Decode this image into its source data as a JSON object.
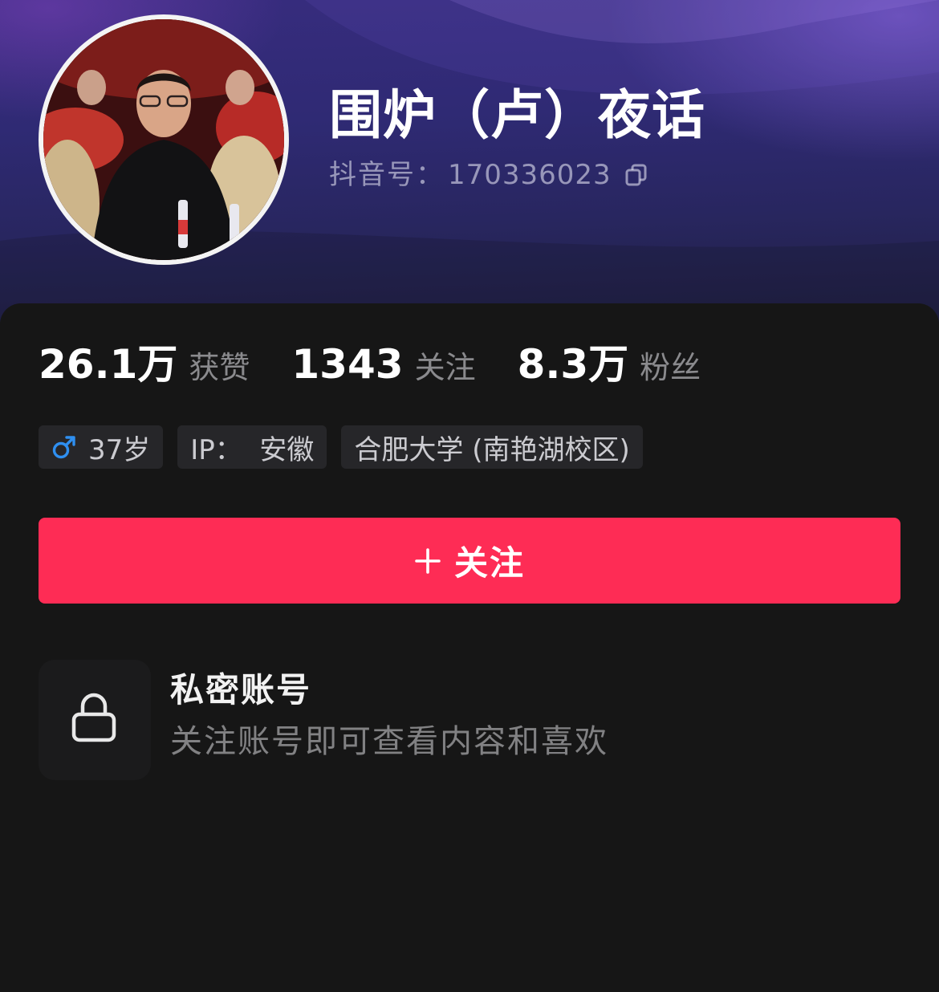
{
  "profile": {
    "name": "围炉（卢）夜话",
    "douyin_id_label": "抖音号：",
    "douyin_id": "170336023",
    "avatar_icon": "avatar-photo",
    "copy_icon": "copy-icon"
  },
  "stats": [
    {
      "value": "26.1万",
      "label": "获赞"
    },
    {
      "value": "1343",
      "label": "关注"
    },
    {
      "value": "8.3万",
      "label": "粉丝"
    }
  ],
  "tags": {
    "gender_icon": "male-icon",
    "gender_color": "#2f8ff0",
    "age": "37岁",
    "ip": "IP：  安徽",
    "school": "合肥大学 (南艳湖校区)"
  },
  "follow_button": {
    "label": "关注",
    "icon": "plus-icon",
    "color": "#fe2c55"
  },
  "private_notice": {
    "icon": "lock-icon",
    "title": "私密账号",
    "description": "关注账号即可查看内容和喜欢"
  }
}
